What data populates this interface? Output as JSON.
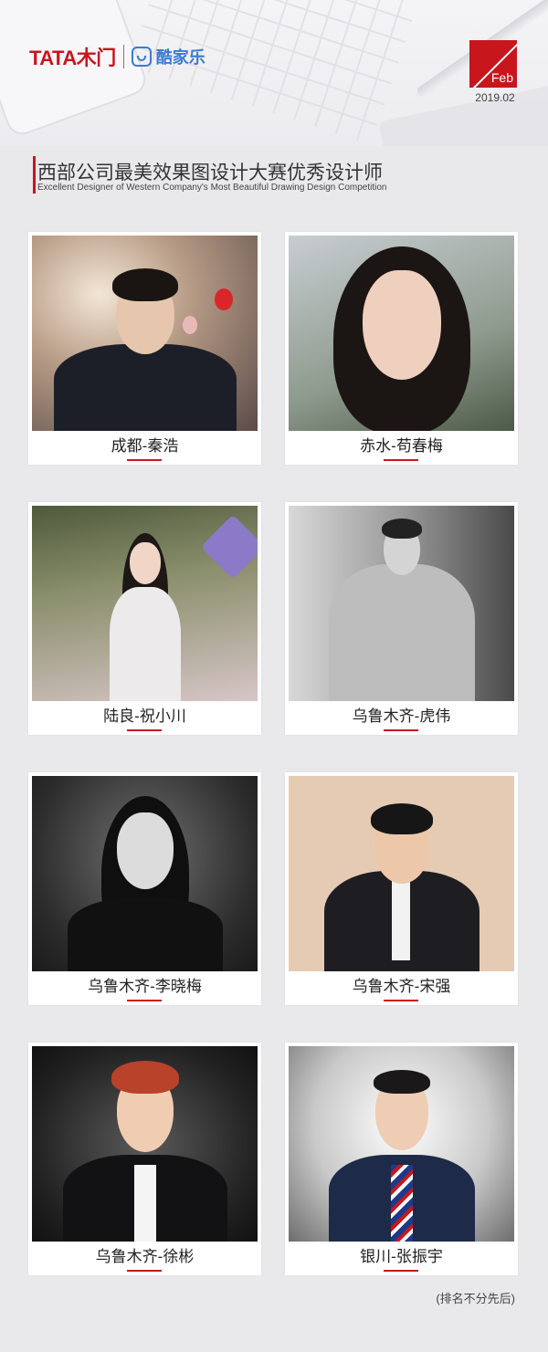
{
  "header": {
    "brand_tata": "TATA木门",
    "brand_kjl": "酷家乐",
    "month": "Feb",
    "date": "2019.02"
  },
  "title": {
    "cn": "西部公司最美效果图设计大赛优秀设计师",
    "en": "Excellent Designer of Western Company's Most Beautiful Drawing Design Competition"
  },
  "designers": [
    {
      "name": "成都-秦浩"
    },
    {
      "name": "赤水-苟春梅"
    },
    {
      "name": "陆良-祝小川"
    },
    {
      "name": "乌鲁木齐-虎伟"
    },
    {
      "name": "乌鲁木齐-李晓梅"
    },
    {
      "name": "乌鲁木齐-宋强"
    },
    {
      "name": "乌鲁木齐-徐彬"
    },
    {
      "name": "银川-张振宇"
    }
  ],
  "footnote": "(排名不分先后)"
}
